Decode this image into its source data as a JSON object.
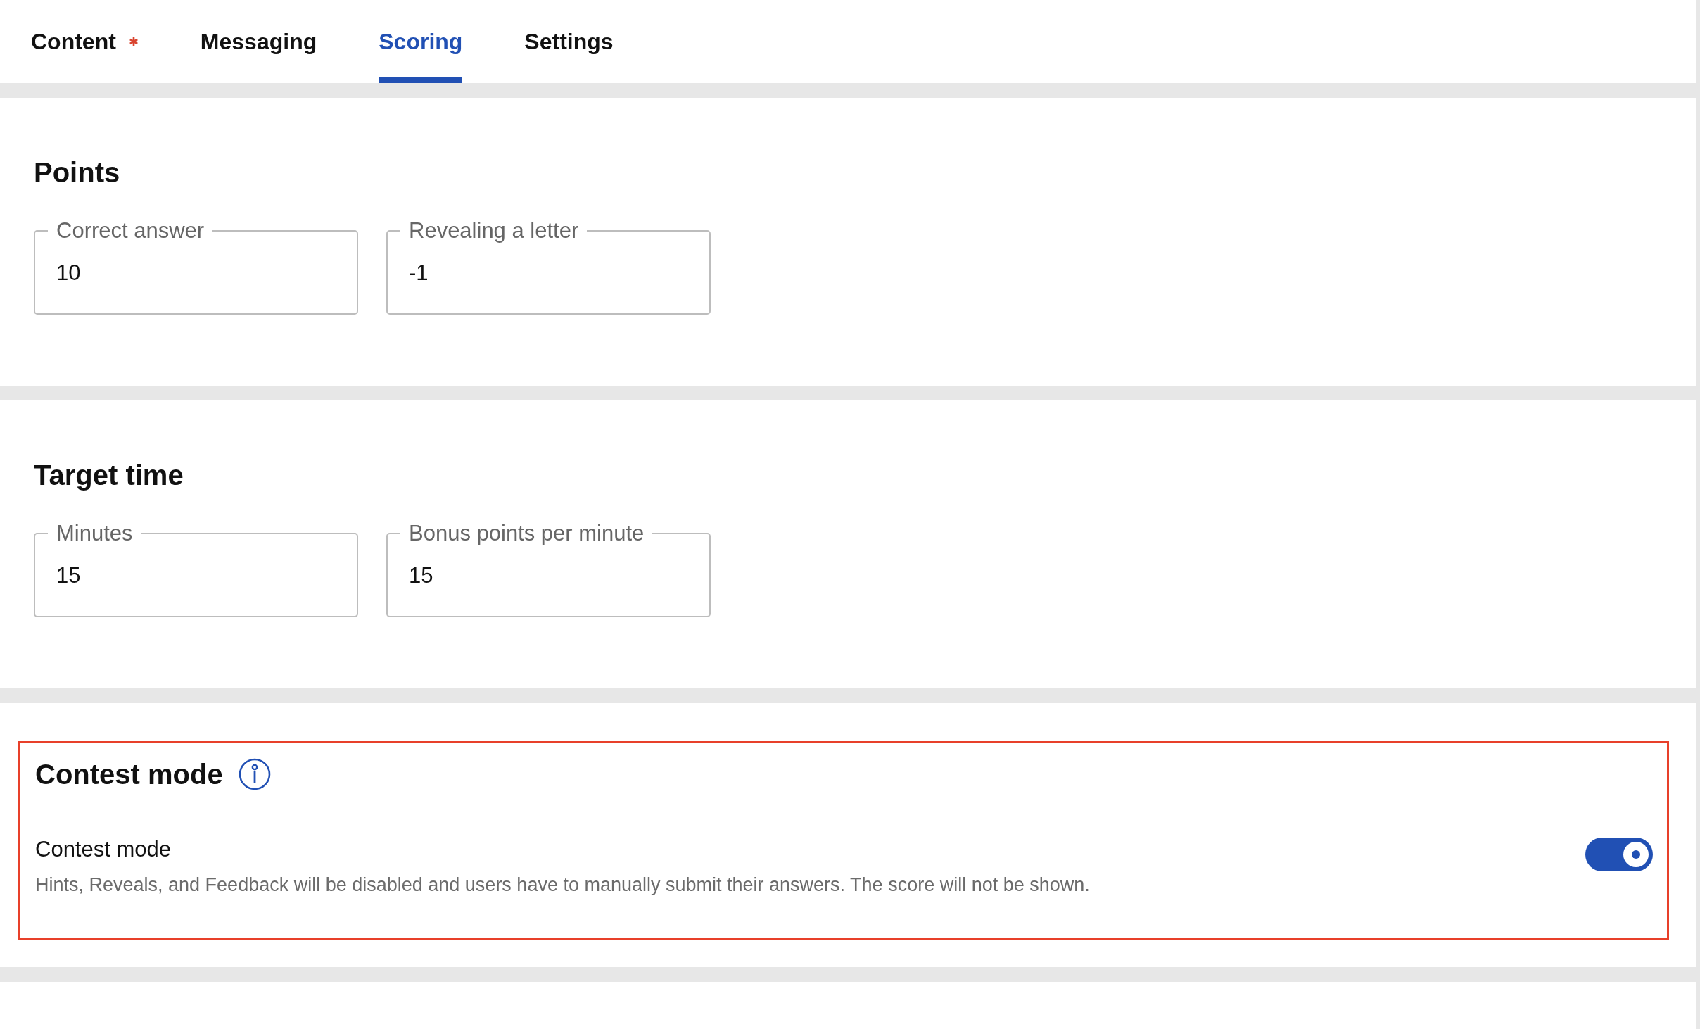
{
  "tabs": [
    {
      "label": "Content",
      "required": true,
      "selected": false
    },
    {
      "label": "Messaging",
      "required": false,
      "selected": false
    },
    {
      "label": "Scoring",
      "required": false,
      "selected": true
    },
    {
      "label": "Settings",
      "required": false,
      "selected": false
    }
  ],
  "sections": [
    {
      "title": "Points",
      "kind": "fields",
      "highlighted": false,
      "fields": [
        {
          "label": "Correct answer",
          "value": "10"
        },
        {
          "label": "Revealing a letter",
          "value": "-1"
        }
      ]
    },
    {
      "title": "Target time",
      "kind": "fields",
      "highlighted": false,
      "fields": [
        {
          "label": "Minutes",
          "value": "15"
        },
        {
          "label": "Bonus points per minute",
          "value": "15"
        }
      ]
    },
    {
      "title": "Contest mode",
      "kind": "toggle",
      "info": true,
      "highlighted": true,
      "setting": {
        "label": "Contest mode",
        "description": "Hints, Reveals, and Feedback will be disabled and users have to manually submit their answers. The score will not be shown.",
        "on": true
      }
    }
  ]
}
